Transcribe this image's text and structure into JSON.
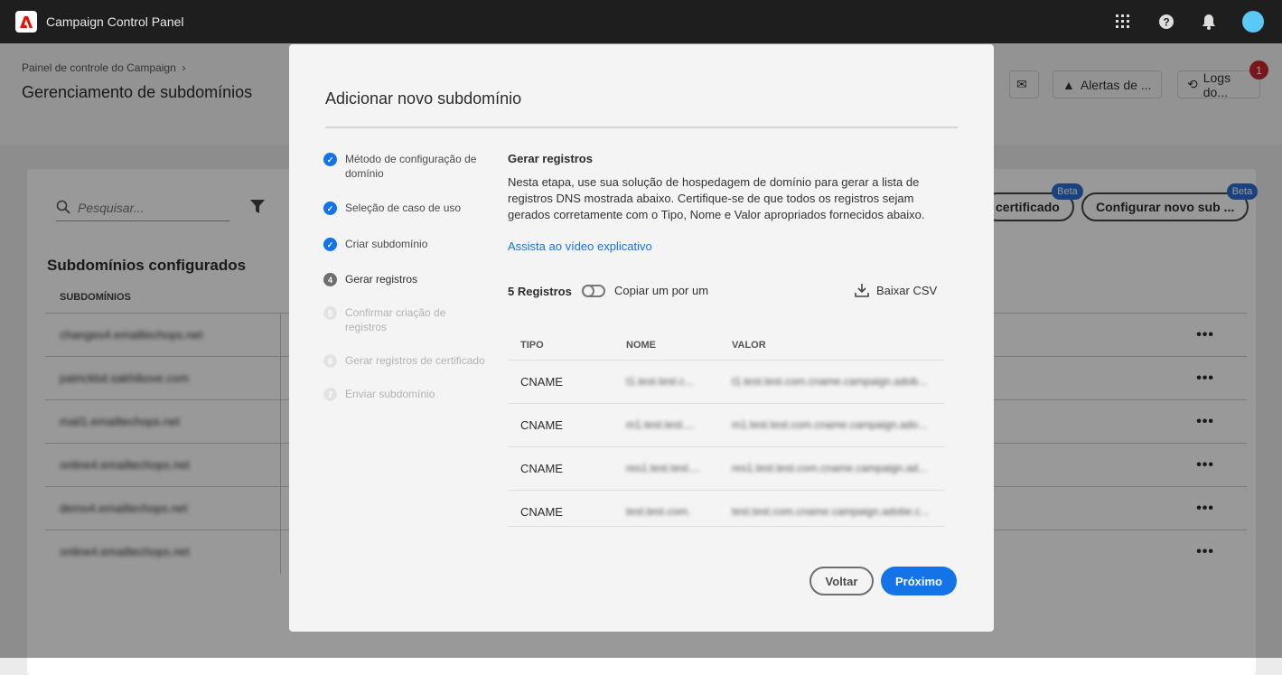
{
  "topbar": {
    "app_title": "Campaign Control Panel",
    "icons": [
      "adobe-logo",
      "apps-grid-icon",
      "help-icon",
      "bell-icon",
      "avatar"
    ]
  },
  "header": {
    "breadcrumb": "Painel de controle do Campaign",
    "title": "Gerenciamento de subdomínios",
    "alerts_label": "Alertas de ...",
    "logs_label": "Logs do...",
    "logs_badge": "1"
  },
  "list": {
    "search_placeholder": "Pesquisar...",
    "cert_button": "certificado",
    "config_button": "Configurar novo sub ...",
    "beta": "Beta",
    "section_title": "Subdomínios configurados",
    "column": "SUBDOMÍNIOS",
    "rows": [
      "changes4.emailtechops.net",
      "patrickbd.sakhibove.com",
      "mail1.emailtechops.net",
      "online4.emailtechops.net",
      "demo4.emailtechops.net",
      "online4.emailtechops.net"
    ]
  },
  "modal": {
    "title": "Adicionar novo subdomínio",
    "steps": [
      {
        "num": "1",
        "label": "Método de configuração de domínio",
        "state": "done"
      },
      {
        "num": "2",
        "label": "Seleção de caso de uso",
        "state": "done"
      },
      {
        "num": "3",
        "label": "Criar subdomínio",
        "state": "done"
      },
      {
        "num": "4",
        "label": "Gerar registros",
        "state": "current"
      },
      {
        "num": "5",
        "label": "Confirmar criação de registros",
        "state": "future"
      },
      {
        "num": "6",
        "label": "Gerar registros de certificado",
        "state": "future"
      },
      {
        "num": "7",
        "label": "Enviar subdomínio",
        "state": "future"
      }
    ],
    "content_title": "Gerar registros",
    "description": "Nesta etapa, use sua solução de hospedagem de domínio para gerar a lista de registros DNS mostrada abaixo. Certifique-se de que todos os registros sejam gerados corretamente com o Tipo, Nome e Valor apropriados fornecidos abaixo.",
    "video_link": "Assista ao vídeo explicativo",
    "record_count": "5 Registros",
    "copy_toggle": "Copiar um por um",
    "copy_toggle_on": false,
    "download_csv": "Baixar CSV",
    "columns": [
      "TIPO",
      "NOME",
      "VALOR"
    ],
    "records": [
      {
        "type": "CNAME",
        "name": "t1.test.test.c...",
        "value": "t1.test.test.com.cname.campaign.adob..."
      },
      {
        "type": "CNAME",
        "name": "m1.test.test....",
        "value": "m1.test.test.com.cname.campaign.ado..."
      },
      {
        "type": "CNAME",
        "name": "res1.test.test....",
        "value": "res1.test.test.com.cname.campaign.ad..."
      },
      {
        "type": "CNAME",
        "name": "test.test.com.",
        "value": "test.test.com.cname.campaign.adobe.c..."
      }
    ],
    "back_button": "Voltar",
    "next_button": "Próximo"
  },
  "colors": {
    "accent": "#1473e6",
    "topbar": "#1e1e1e",
    "badge": "#c9252d",
    "beta": "#2b6ed2"
  }
}
